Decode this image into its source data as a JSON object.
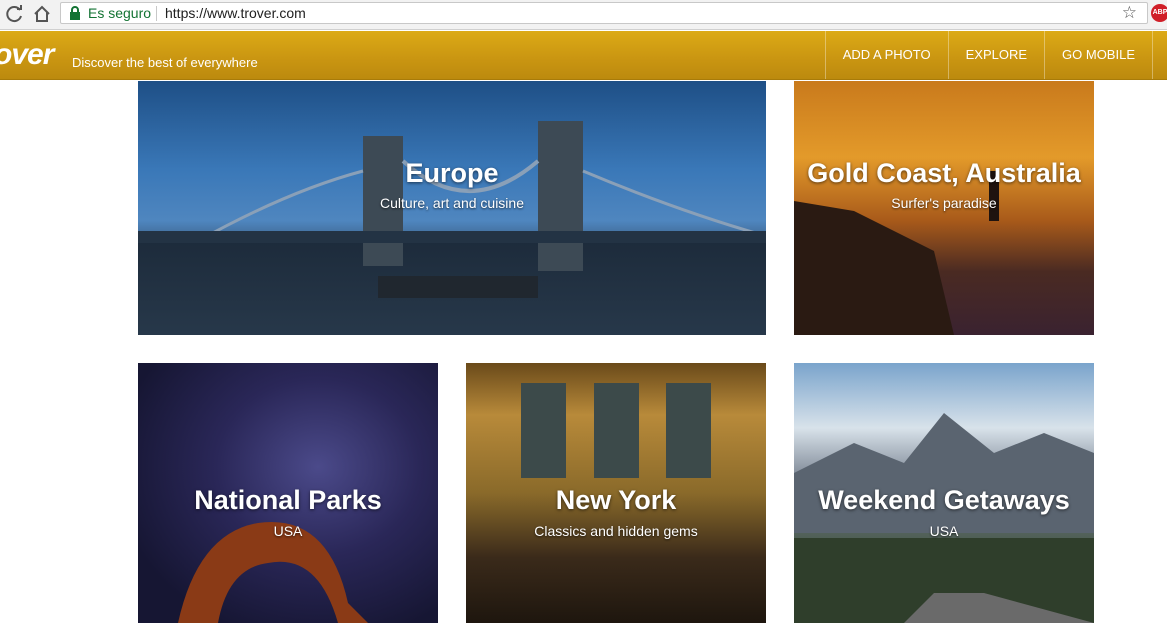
{
  "browser": {
    "secure_label": "Es seguro",
    "url": "https://www.trover.com",
    "extension_badge": "ABP"
  },
  "site": {
    "logo": "over",
    "tagline": "Discover the best of everywhere",
    "nav": [
      "ADD A PHOTO",
      "EXPLORE",
      "GO MOBILE"
    ]
  },
  "cards": [
    {
      "title": "Europe",
      "subtitle": "Culture, art and cuisine"
    },
    {
      "title": "Gold Coast, Australia",
      "subtitle": "Surfer's paradise"
    },
    {
      "title": "National Parks",
      "subtitle": "USA"
    },
    {
      "title": "New York",
      "subtitle": "Classics and hidden gems"
    },
    {
      "title": "Weekend Getaways",
      "subtitle": "USA"
    }
  ]
}
